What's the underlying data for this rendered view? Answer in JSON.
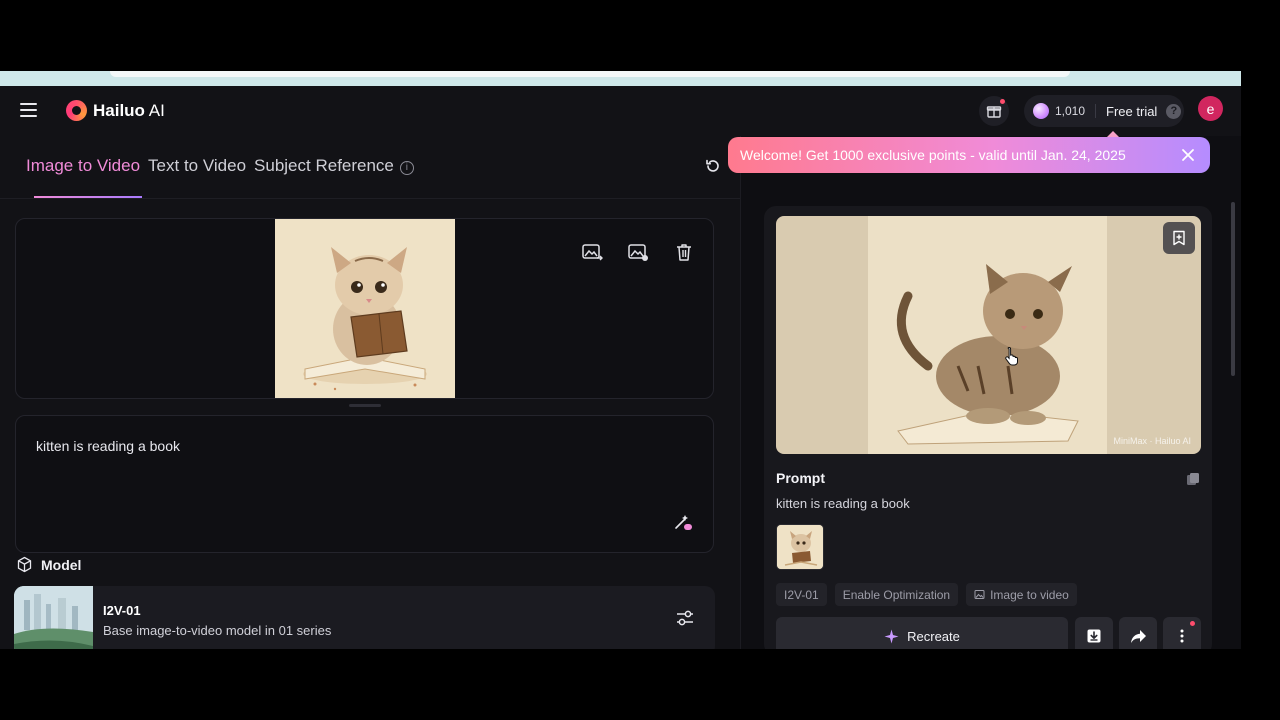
{
  "app": {
    "brand_main": "Hailuo",
    "brand_suffix": " AI"
  },
  "header": {
    "points": "1,010",
    "free_trial": "Free trial",
    "help": "?",
    "avatar_initial": "e"
  },
  "tabs": [
    {
      "label": "Image to Video",
      "active": true
    },
    {
      "label": "Text to Video",
      "active": false
    },
    {
      "label": "Subject Reference",
      "active": false
    }
  ],
  "info_glyph": "i",
  "prompt": {
    "value": "kitten is reading a book"
  },
  "model": {
    "section_label": "Model",
    "name": "I2V-01",
    "description": "Base image-to-video model in 01 series"
  },
  "toast": {
    "message": "Welcome! Get 1000 exclusive points - valid until Jan. 24, 2025"
  },
  "result": {
    "prompt_title": "Prompt",
    "prompt_value": "kitten is reading a book",
    "watermark": "MiniMax · Hailuo AI",
    "chips": [
      "I2V-01",
      "Enable Optimization",
      "Image to video"
    ],
    "recreate_label": "Recreate"
  },
  "colors": {
    "accent": "#f08bd8",
    "avatar": "#d1265f",
    "toast_start": "#ff7a8e",
    "toast_end": "#b58cff"
  },
  "icons": [
    "menu-icon",
    "brand-logo-icon",
    "gift-icon",
    "gem-icon",
    "help-icon",
    "refresh-icon",
    "replace-image-icon",
    "edit-image-icon",
    "trash-icon",
    "magic-wand-icon",
    "cube-icon",
    "sliders-icon",
    "close-icon",
    "bookmark-icon",
    "copy-icon",
    "image-icon",
    "sparkle-icon",
    "download-icon",
    "share-icon",
    "more-icon"
  ]
}
